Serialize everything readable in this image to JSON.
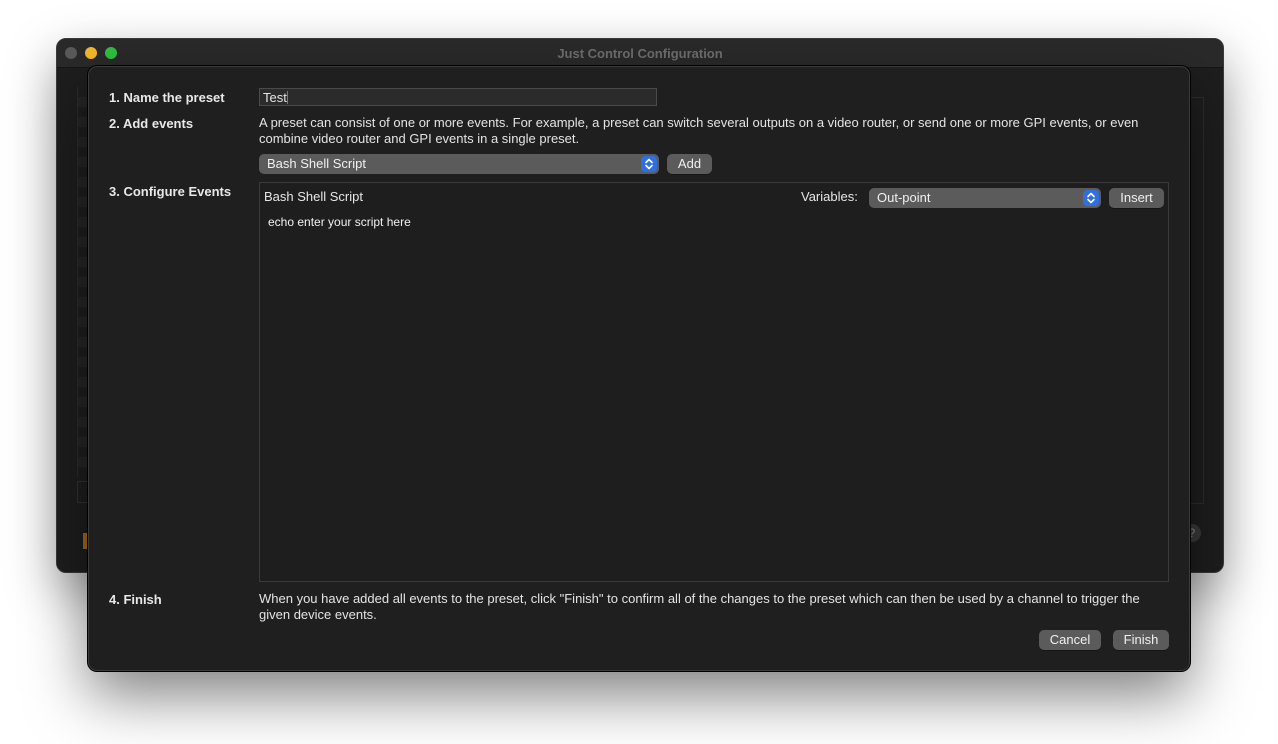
{
  "window": {
    "title": "Just Control Configuration",
    "help_glyph": "?"
  },
  "steps": {
    "name": {
      "label": "1. Name the preset",
      "value": "Test"
    },
    "add": {
      "label": "2. Add events",
      "description": "A preset can consist of one or more events. For example, a preset can switch several outputs on a video router, or send one or more GPI events, or even combine video router and GPI events in a single preset.",
      "event_type_selected": "Bash Shell Script",
      "add_button": "Add"
    },
    "configure": {
      "label": "3. Configure Events",
      "event_title": "Bash Shell Script",
      "variables_label": "Variables:",
      "variable_selected": "Out-point",
      "insert_button": "Insert",
      "script": "echo enter your script here"
    },
    "finish": {
      "label": "4. Finish",
      "description": "When you have added all events to the preset, click \"Finish\" to confirm all of the changes to the preset which can then be used by a channel to trigger the given device events.",
      "cancel_button": "Cancel",
      "finish_button": "Finish"
    }
  },
  "icons": {
    "select_arrows": "chevron-updown-icon",
    "close": "close-icon",
    "minimize": "minimize-icon",
    "maximize": "maximize-icon"
  },
  "colors": {
    "accent": "#2f6fe0",
    "sheet_background": "#1f1f1f",
    "button_background": "#5b5b5b"
  }
}
